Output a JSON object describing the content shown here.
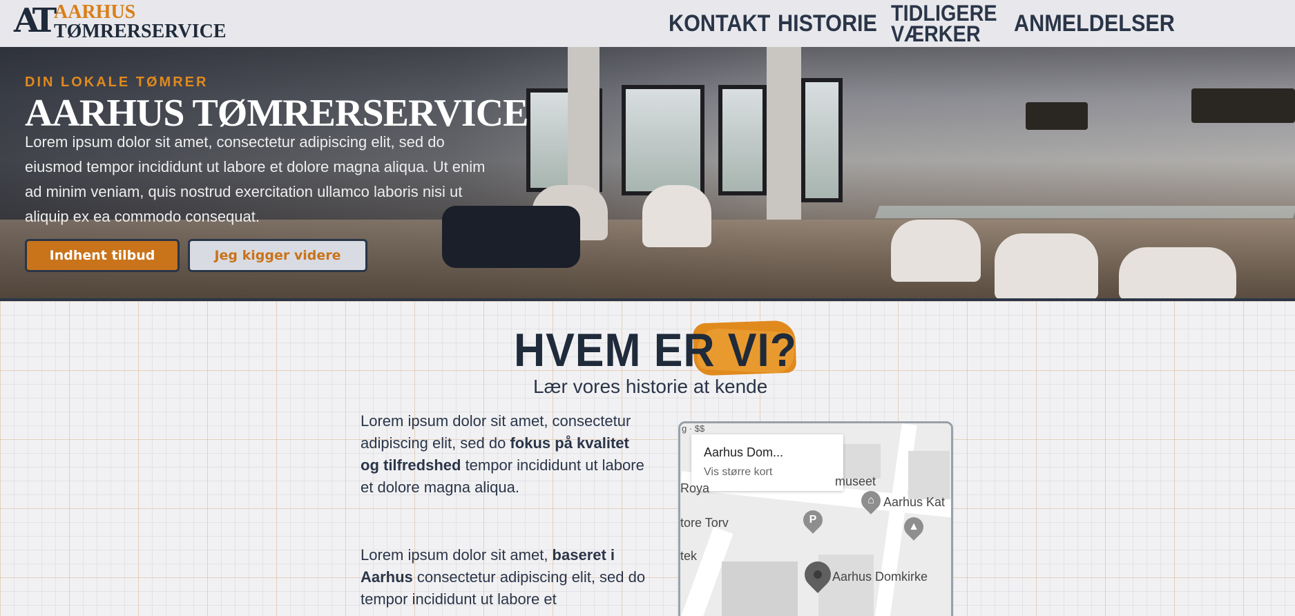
{
  "header": {
    "logo_mark": "AT",
    "logo_line1": "AARHUS",
    "logo_line2": "TØMRERSERVICE",
    "nav": [
      "KONTAKT",
      "HISTORIE",
      "TIDLIGERE VÆRKER",
      "ANMELDELSER"
    ]
  },
  "hero": {
    "kicker": "DIN LOKALE TØMRER",
    "title": "AARHUS TØMRERSERVICE",
    "text": "Lorem ipsum dolor sit amet, consectetur adipiscing elit, sed do eiusmod tempor incididunt ut labore et dolore magna aliqua. Ut enim ad minim veniam, quis nostrud exercitation ullamco laboris nisi ut aliquip ex ea commodo consequat.",
    "primary_button": "Indhent tilbud",
    "secondary_button": "Jeg kigger videre"
  },
  "about": {
    "title_part1": "HVEM ER ",
    "title_part2": "VI?",
    "subtitle": "Lær vores historie at kende",
    "para1_a": "Lorem ipsum dolor sit amet, consectetur adipiscing elit, sed do ",
    "para1_bold": "fokus på kvalitet og tilfredshed",
    "para1_b": " tempor incididunt ut labore et dolore magna aliqua.",
    "para2_a": "Lorem ipsum dolor sit amet, ",
    "para2_bold": "baseret i Aarhus",
    "para2_b": " consectetur adipiscing elit, sed do tempor incididunt ut labore et"
  },
  "map": {
    "card_title": "Aarhus Dom...",
    "card_link": "Vis større kort",
    "tag": "g · $$",
    "labels": [
      "museet",
      "Aarhus Kat",
      "Roya",
      "tore Torv",
      "tek",
      "Aarhus Domkirke"
    ],
    "parking_glyph": "P"
  },
  "colors": {
    "accent": "#e08a1e",
    "navy": "#1f2a3a",
    "button_primary": "#c9731a"
  }
}
